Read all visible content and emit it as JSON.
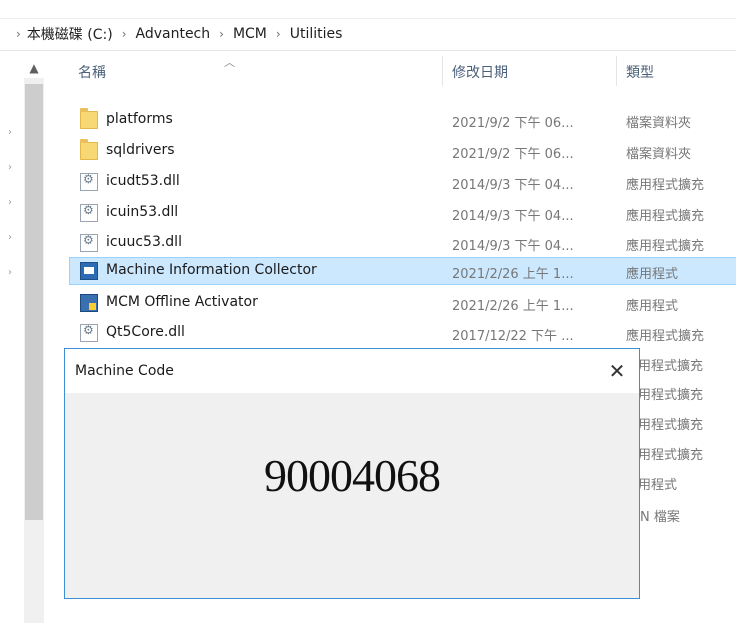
{
  "breadcrumb": [
    "本機磁碟 (C:)",
    "Advantech",
    "MCM",
    "Utilities"
  ],
  "columns": {
    "name": "名稱",
    "modified": "修改日期",
    "type": "類型"
  },
  "files": [
    {
      "name": "platforms",
      "date": "2021/9/2 下午 06...",
      "type": "檔案資料夾",
      "icon": "folder-icon"
    },
    {
      "name": "sqldrivers",
      "date": "2021/9/2 下午 06...",
      "type": "檔案資料夾",
      "icon": "folder-icon"
    },
    {
      "name": "icudt53.dll",
      "date": "2014/9/3 下午 04...",
      "type": "應用程式擴充",
      "icon": "dll-file-icon"
    },
    {
      "name": "icuin53.dll",
      "date": "2014/9/3 下午 04...",
      "type": "應用程式擴充",
      "icon": "dll-file-icon"
    },
    {
      "name": "icuuc53.dll",
      "date": "2014/9/3 下午 04...",
      "type": "應用程式擴充",
      "icon": "dll-file-icon"
    },
    {
      "name": "Machine Information Collector",
      "date": "2021/2/26 上午 1...",
      "type": "應用程式",
      "icon": "application-icon",
      "selected": true
    },
    {
      "name": "MCM Offline Activator",
      "date": "2021/2/26 上午 1...",
      "type": "應用程式",
      "icon": "application-icon"
    },
    {
      "name": "Qt5Core.dll",
      "date": "2017/12/22 下午 ...",
      "type": "應用程式擴充",
      "icon": "dll-file-icon"
    }
  ],
  "hidden_types": [
    "用程式擴充",
    "用程式擴充",
    "用程式擴充",
    "用程式擴充",
    "用程式",
    "DN 檔案"
  ],
  "dialog": {
    "title": "Machine Code",
    "close": "✕",
    "code": "90004068"
  },
  "colors": {
    "selection": "#cce8ff",
    "dialog_border": "#3c8fd4",
    "folder": "#f8d775"
  }
}
